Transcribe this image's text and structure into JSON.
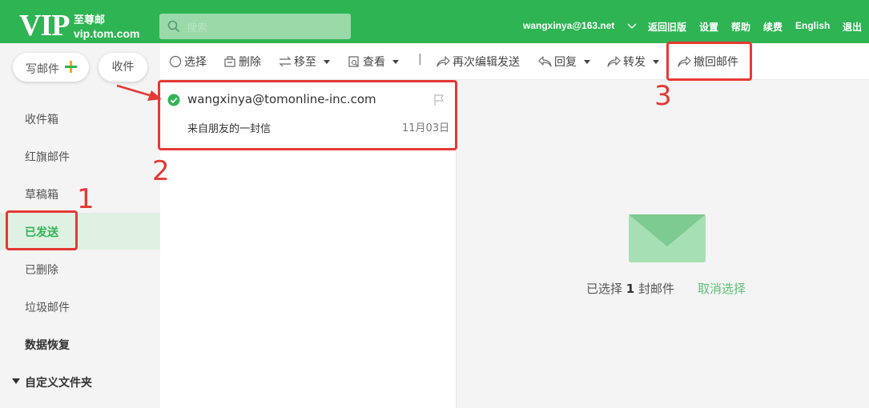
{
  "header": {
    "logo_vip": "VIP",
    "logo_zh": "至尊邮",
    "logo_domain": "vip.tom.com",
    "search_placeholder": "搜索",
    "account": "wangxinya@163.net",
    "links": [
      "返回旧版",
      "设置",
      "帮助",
      "续费",
      "English",
      "退出"
    ],
    "bg_color": "#2fb454"
  },
  "sidebar": {
    "compose_label": "写邮件",
    "receive_label": "收件",
    "items": [
      {
        "label": "收件箱",
        "icon": null
      },
      {
        "label": "红旗邮件",
        "icon": null
      },
      {
        "label": "草稿箱",
        "icon": null
      },
      {
        "label": "已发送",
        "icon": null,
        "active": true
      },
      {
        "label": "已删除",
        "icon": null
      },
      {
        "label": "垃圾邮件",
        "icon": null
      },
      {
        "label": "数据恢复",
        "icon": null
      },
      {
        "label": "自定义文件夹",
        "icon": "triangle-down-icon"
      }
    ]
  },
  "toolbar": {
    "select": "选择",
    "delete": "删除",
    "move": "移至",
    "view": "查看",
    "separator": "|",
    "reedit": "再次编辑发送",
    "reply": "回复",
    "forward": "转发",
    "recall": "撤回邮件"
  },
  "mail_list": {
    "items": [
      {
        "from": "wangxinya@tomonline-inc.com",
        "subject": "来自朋友的一封信",
        "date": "11月03日",
        "selected": true
      }
    ]
  },
  "preview": {
    "selected_prefix": "已选择",
    "selected_count": "1",
    "selected_suffix": "封邮件",
    "cancel_selection": "取消选择"
  },
  "annotations": {
    "labels": [
      "1",
      "2",
      "3"
    ],
    "color": "#e53935"
  }
}
